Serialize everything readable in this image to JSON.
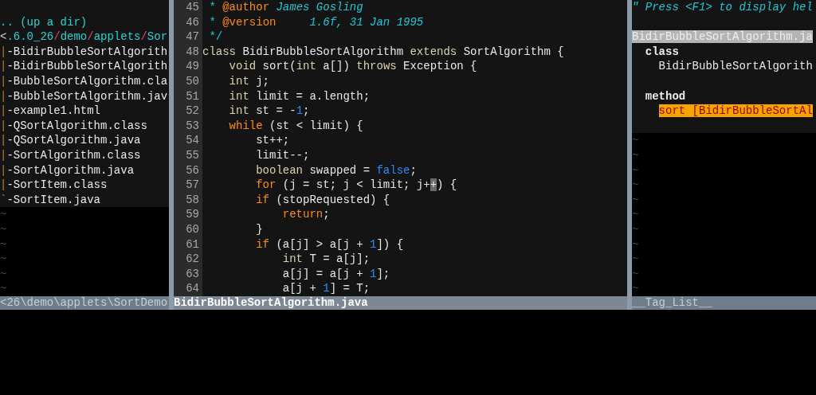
{
  "file_explorer": {
    "rows": [
      {
        "kind": "blank"
      },
      {
        "kind": "parent",
        "text": ".. (up a dir)"
      },
      {
        "kind": "path",
        "segments": [
          {
            "text": "<",
            "kind": "plain"
          },
          {
            "text": ".6.0_26",
            "kind": "dir"
          },
          {
            "text": "/",
            "kind": "sep"
          },
          {
            "text": "demo",
            "kind": "dir"
          },
          {
            "text": "/",
            "kind": "sep"
          },
          {
            "text": "applets",
            "kind": "dir"
          },
          {
            "text": "/",
            "kind": "sep"
          },
          {
            "text": "Sor",
            "kind": "dir"
          }
        ]
      },
      {
        "kind": "file",
        "branch": "|",
        "text": "-BidirBubbleSortAlgorith"
      },
      {
        "kind": "file",
        "branch": "|",
        "text": "-BidirBubbleSortAlgorith"
      },
      {
        "kind": "file",
        "branch": "|",
        "text": "-BubbleSortAlgorithm.cla"
      },
      {
        "kind": "file",
        "branch": "|",
        "text": "-BubbleSortAlgorithm.jav"
      },
      {
        "kind": "file",
        "branch": "|",
        "text": "-example1.html"
      },
      {
        "kind": "file",
        "branch": "|",
        "text": "-QSortAlgorithm.class"
      },
      {
        "kind": "file",
        "branch": "|",
        "text": "-QSortAlgorithm.java"
      },
      {
        "kind": "file",
        "branch": "|",
        "text": "-SortAlgorithm.class"
      },
      {
        "kind": "file",
        "branch": "|",
        "text": "-SortAlgorithm.java"
      },
      {
        "kind": "file",
        "branch": "|",
        "text": "-SortItem.class"
      },
      {
        "kind": "file",
        "branch": "`",
        "text": "-SortItem.java"
      }
    ],
    "empty_line_markers": [
      "~",
      "~",
      "~",
      "~",
      "~",
      "~"
    ],
    "status_line": "<26\\demo\\applets\\SortDemo",
    "active": false
  },
  "editor": {
    "lines": [
      {
        "number": "45",
        "tokens": [
          {
            "text": " * ",
            "kind": "comment"
          },
          {
            "text": "@author",
            "kind": "tag"
          },
          {
            "text": " James Gosling",
            "kind": "comment_italic"
          }
        ]
      },
      {
        "number": "46",
        "tokens": [
          {
            "text": " * ",
            "kind": "comment"
          },
          {
            "text": "@version",
            "kind": "tag"
          },
          {
            "text": "     1.6f, 31 Jan 1995",
            "kind": "comment_italic"
          }
        ]
      },
      {
        "number": "47",
        "tokens": [
          {
            "text": " */",
            "kind": "comment"
          }
        ]
      },
      {
        "number": "48",
        "tokens": [
          {
            "text": "class",
            "kind": "type"
          },
          {
            "text": " BidirBubbleSortAlgorithm ",
            "kind": "plain"
          },
          {
            "text": "extends",
            "kind": "type"
          },
          {
            "text": " SortAlgorithm {",
            "kind": "plain"
          }
        ]
      },
      {
        "number": "49",
        "tokens": [
          {
            "text": "    void",
            "kind": "type"
          },
          {
            "text": " sort(",
            "kind": "plain"
          },
          {
            "text": "int",
            "kind": "type"
          },
          {
            "text": " a[]) ",
            "kind": "plain"
          },
          {
            "text": "throws",
            "kind": "type"
          },
          {
            "text": " Exception {",
            "kind": "plain"
          }
        ]
      },
      {
        "number": "50",
        "tokens": [
          {
            "text": "    int",
            "kind": "type"
          },
          {
            "text": " j;",
            "kind": "plain"
          }
        ]
      },
      {
        "number": "51",
        "tokens": [
          {
            "text": "    int",
            "kind": "type"
          },
          {
            "text": " limit = a.length;",
            "kind": "plain"
          }
        ]
      },
      {
        "number": "52",
        "tokens": [
          {
            "text": "    int",
            "kind": "type"
          },
          {
            "text": " st = -",
            "kind": "plain"
          },
          {
            "text": "1",
            "kind": "number"
          },
          {
            "text": ";",
            "kind": "plain"
          }
        ]
      },
      {
        "number": "53",
        "tokens": [
          {
            "text": "    while",
            "kind": "keyword"
          },
          {
            "text": " (st < limit) {",
            "kind": "plain"
          }
        ]
      },
      {
        "number": "54",
        "tokens": [
          {
            "text": "        st++;",
            "kind": "plain"
          }
        ]
      },
      {
        "number": "55",
        "tokens": [
          {
            "text": "        limit--;",
            "kind": "plain"
          }
        ]
      },
      {
        "number": "56",
        "tokens": [
          {
            "text": "        boolean",
            "kind": "type"
          },
          {
            "text": " swapped = ",
            "kind": "plain"
          },
          {
            "text": "false",
            "kind": "number"
          },
          {
            "text": ";",
            "kind": "plain"
          }
        ]
      },
      {
        "number": "57",
        "tokens": [
          {
            "text": "        for",
            "kind": "keyword"
          },
          {
            "text": " (j = st; j < limit; j+",
            "kind": "plain"
          },
          {
            "text": "+",
            "kind": "cursor"
          },
          {
            "text": ") {",
            "kind": "plain"
          }
        ]
      },
      {
        "number": "58",
        "tokens": [
          {
            "text": "        if",
            "kind": "keyword"
          },
          {
            "text": " (stopRequested) {",
            "kind": "plain"
          }
        ]
      },
      {
        "number": "59",
        "tokens": [
          {
            "text": "            return",
            "kind": "keyword"
          },
          {
            "text": ";",
            "kind": "plain"
          }
        ]
      },
      {
        "number": "60",
        "tokens": [
          {
            "text": "        }",
            "kind": "plain"
          }
        ]
      },
      {
        "number": "61",
        "tokens": [
          {
            "text": "        if",
            "kind": "keyword"
          },
          {
            "text": " (a[j] > a[j + ",
            "kind": "plain"
          },
          {
            "text": "1",
            "kind": "number"
          },
          {
            "text": "]) {",
            "kind": "plain"
          }
        ]
      },
      {
        "number": "62",
        "tokens": [
          {
            "text": "            int",
            "kind": "type"
          },
          {
            "text": " T = a[j];",
            "kind": "plain"
          }
        ]
      },
      {
        "number": "63",
        "tokens": [
          {
            "text": "            a[j] = a[j + ",
            "kind": "plain"
          },
          {
            "text": "1",
            "kind": "number"
          },
          {
            "text": "];",
            "kind": "plain"
          }
        ]
      },
      {
        "number": "64",
        "tokens": [
          {
            "text": "            a[j + ",
            "kind": "plain"
          },
          {
            "text": "1",
            "kind": "number"
          },
          {
            "text": "] = T;",
            "kind": "plain"
          }
        ]
      }
    ],
    "status_line": "BidirBubbleSortAlgorithm.java",
    "active": true
  },
  "tag_list": {
    "rows": [
      {
        "kind": "help",
        "text": "\" Press <F1> to display hel"
      },
      {
        "kind": "blank"
      },
      {
        "kind": "file",
        "text": "BidirBubbleSortAlgorithm.ja"
      },
      {
        "kind": "category",
        "text": "class"
      },
      {
        "kind": "tag",
        "text": "BidirBubbleSortAlgorith",
        "selected": false
      },
      {
        "kind": "blank"
      },
      {
        "kind": "category",
        "text": "method"
      },
      {
        "kind": "tag",
        "text": "sort [BidirBubbleSortAl",
        "selected": true
      },
      {
        "kind": "blank"
      }
    ],
    "empty_line_markers": [
      "~",
      "~",
      "~",
      "~",
      "~",
      "~",
      "~",
      "~",
      "~",
      "~",
      "~"
    ],
    "status_line": "__Tag_List__",
    "active": false
  }
}
